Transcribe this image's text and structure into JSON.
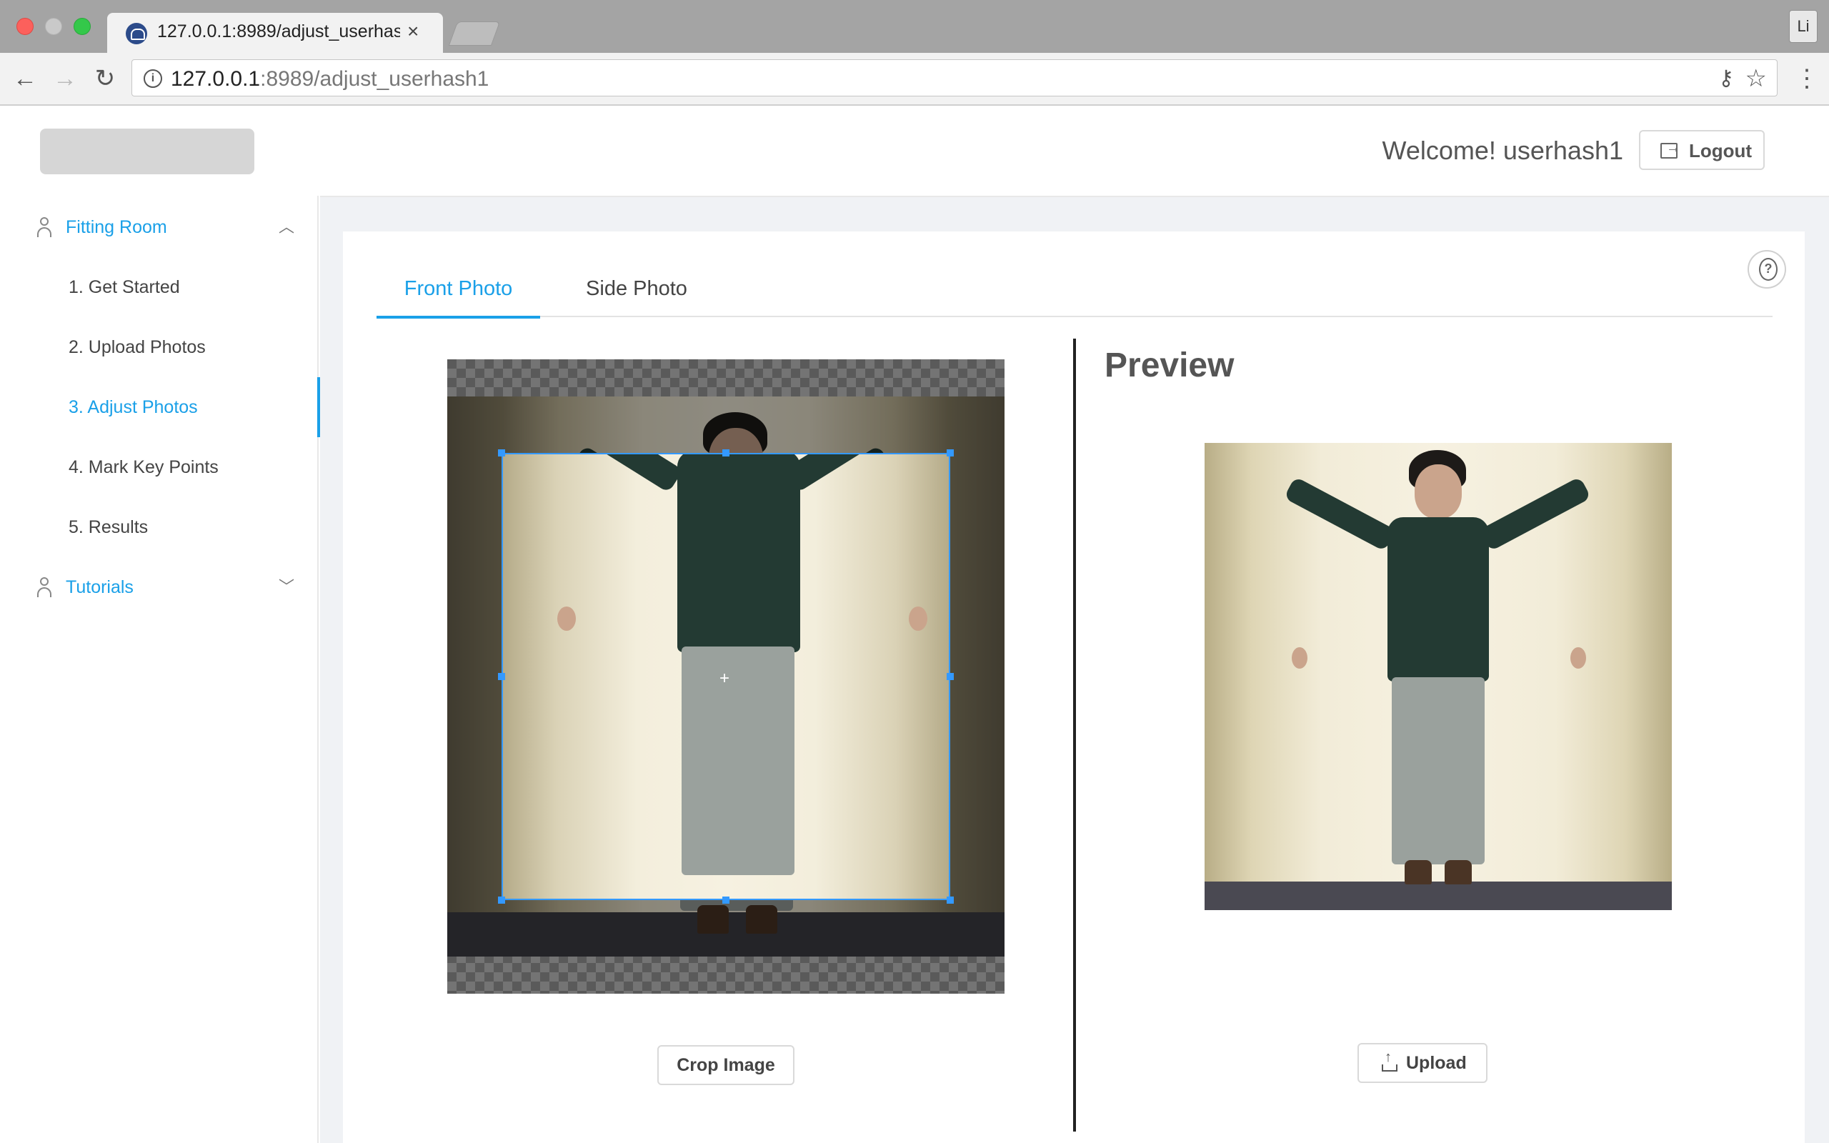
{
  "browser": {
    "tab_title": "127.0.0.1:8989/adjust_userhash1",
    "tab_close": "×",
    "profile_initials": "Li",
    "url_host": "127.0.0.1",
    "url_rest": ":8989/adjust_userhash1"
  },
  "header": {
    "welcome_text": "Welcome! userhash1",
    "logout_label": "Logout"
  },
  "sidebar": {
    "fitting_room": {
      "label": "Fitting Room",
      "expanded": true,
      "items": [
        {
          "label": "1. Get Started"
        },
        {
          "label": "2. Upload Photos"
        },
        {
          "label": "3. Adjust Photos",
          "active": true
        },
        {
          "label": "4. Mark Key Points"
        },
        {
          "label": "5. Results"
        }
      ]
    },
    "tutorials": {
      "label": "Tutorials",
      "expanded": false
    }
  },
  "main": {
    "tabs": [
      {
        "label": "Front Photo",
        "active": true
      },
      {
        "label": "Side Photo",
        "active": false
      }
    ],
    "preview_title": "Preview",
    "crop_button_label": "Crop Image",
    "upload_button_label": "Upload"
  },
  "icons": {
    "back": "back-arrow-icon",
    "forward": "forward-arrow-icon",
    "reload": "reload-icon",
    "info": "info-icon",
    "key": "key-icon",
    "bookmark": "star-icon",
    "menu": "kebab-menu-icon",
    "user": "user-icon",
    "help": "question-circle-icon",
    "logout": "logout-icon",
    "upload": "upload-icon"
  },
  "colors": {
    "accent": "#1aa0e8",
    "crop_frame": "#3399ff",
    "content_bg": "#f0f2f5"
  }
}
